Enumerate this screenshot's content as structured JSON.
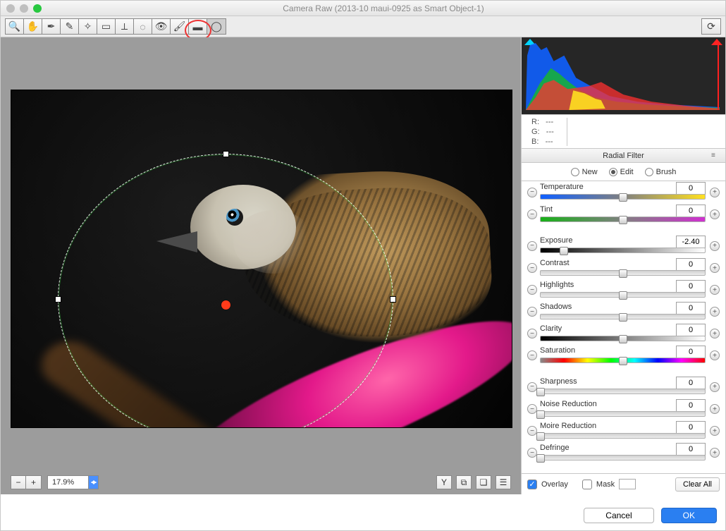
{
  "window": {
    "title": "Camera Raw (2013-10 maui-0925 as Smart Object-1)"
  },
  "toolbar": {
    "tools": [
      {
        "name": "zoom-tool",
        "glyph": "🔍"
      },
      {
        "name": "hand-tool",
        "glyph": "✋"
      },
      {
        "name": "white-balance-tool",
        "glyph": "✒"
      },
      {
        "name": "color-sampler-tool",
        "glyph": "✎"
      },
      {
        "name": "targeted-adjustment-tool",
        "glyph": "✧"
      },
      {
        "name": "crop-tool",
        "glyph": "▭"
      },
      {
        "name": "straighten-tool",
        "glyph": "⟂"
      },
      {
        "name": "spot-removal-tool",
        "glyph": "◌"
      },
      {
        "name": "red-eye-tool",
        "glyph": "👁"
      },
      {
        "name": "adjustment-brush-tool",
        "glyph": "🖌"
      },
      {
        "name": "graduated-filter-tool",
        "glyph": "▬"
      },
      {
        "name": "radial-filter-tool",
        "glyph": "◯",
        "selected": true
      }
    ],
    "rotate": {
      "name": "rotate",
      "glyph": "⟳"
    }
  },
  "histogram": {
    "clip_shadows": true,
    "clip_highlights": true
  },
  "readout": {
    "r": "R:",
    "g": "G:",
    "b": "B:",
    "dash": "---"
  },
  "panel": {
    "title": "Radial Filter",
    "modes": {
      "new": "New",
      "edit": "Edit",
      "brush": "Brush",
      "selected": "edit"
    },
    "overlay": {
      "overlay_label": "Overlay",
      "overlay_on": true,
      "mask_label": "Mask",
      "mask_on": false,
      "clear_all": "Clear All"
    }
  },
  "sliders": [
    {
      "key": "temperature",
      "label": "Temperature",
      "value": "0",
      "thumb": 0.5,
      "gradient": "linear-gradient(90deg,#1060ff,#808080,#ffe020)"
    },
    {
      "key": "tint",
      "label": "Tint",
      "value": "0",
      "thumb": 0.5,
      "gradient": "linear-gradient(90deg,#18b018,#808080,#d030d0)"
    },
    {
      "key": "exposure",
      "label": "Exposure",
      "value": "-2.40",
      "thumb": 0.14,
      "gradient": "linear-gradient(90deg,#000,#fff)"
    },
    {
      "key": "contrast",
      "label": "Contrast",
      "value": "0",
      "thumb": 0.5
    },
    {
      "key": "highlights",
      "label": "Highlights",
      "value": "0",
      "thumb": 0.5
    },
    {
      "key": "shadows",
      "label": "Shadows",
      "value": "0",
      "thumb": 0.5
    },
    {
      "key": "clarity",
      "label": "Clarity",
      "value": "0",
      "thumb": 0.5,
      "gradient": "linear-gradient(90deg,#000,#fff)"
    },
    {
      "key": "saturation",
      "label": "Saturation",
      "value": "0",
      "thumb": 0.5,
      "gradient": "linear-gradient(90deg,#888,#f00,#ff0,#0f0,#0ff,#00f,#f0f,#f00)"
    },
    {
      "key": "sharpness",
      "label": "Sharpness",
      "value": "0",
      "thumb": 0.0
    },
    {
      "key": "noise_reduction",
      "label": "Noise Reduction",
      "value": "0",
      "thumb": 0.0
    },
    {
      "key": "moire_reduction",
      "label": "Moire Reduction",
      "value": "0",
      "thumb": 0.0
    },
    {
      "key": "defringe",
      "label": "Defringe",
      "value": "0",
      "thumb": 0.0
    }
  ],
  "slider_groups": [
    [
      0,
      1
    ],
    [
      2,
      3,
      4,
      5,
      6,
      7
    ],
    [
      8,
      9,
      10,
      11
    ]
  ],
  "canvas_bottom": {
    "zoom": "17.9%"
  },
  "footer": {
    "cancel": "Cancel",
    "ok": "OK"
  },
  "chart_data": null
}
